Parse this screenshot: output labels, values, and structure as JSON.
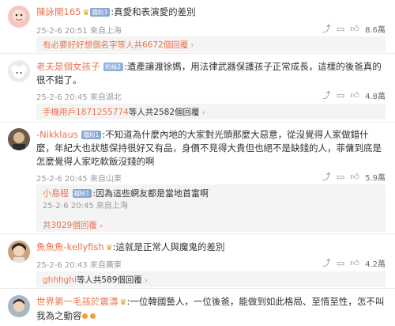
{
  "comments": [
    {
      "username": "陳詠開165",
      "badge": "鐵粉3",
      "separator": ":",
      "text": "真愛和表演愛的差別",
      "time": "25-2-6 20:51",
      "location": "來自上海",
      "likes": "8.6萬",
      "reply_summary": "有必要好好想個名字等人共6672個回覆",
      "avatar_icon": "avatar-pink-face"
    },
    {
      "username": "老夫是個女孩子",
      "badge": "粉絲2",
      "separator": ":",
      "text": "遺產讓渡徐媽，用法律武器保護孩子正常成長，這樣的後爸真的很不錯了。",
      "time": "25-2-6 20:45",
      "location": "來自湖北",
      "likes": "4.8萬",
      "reply_summary_user": "手機用戶1871255774",
      "reply_summary_rest": "等人共2582個回覆",
      "avatar_icon": "avatar-sheep"
    },
    {
      "username": "-Nikklaus",
      "badge": "鐵粉1",
      "separator": ":",
      "text": "不知道為什麼內地的大家對光頭那麼大惡意，從沒覺得人家做錯什麼，年紀大也狀態保持很好又有品，身價不見得大貴但也絕不是缺錢的人，菲傭到底是怎麼覺得人家吃軟飯沒錢的啊",
      "time": "25-2-6 20:45",
      "location": "來自山東",
      "likes": "5.9萬",
      "subreply": {
        "username": "小島程",
        "badge": "鐵粉1",
        "separator": ":",
        "text": "因為這些網友都是當地首富啊",
        "time": "25-2-6 20:45",
        "location": "來自上海"
      },
      "reply_summary": "共3029個回覆",
      "avatar_icon": "avatar-man"
    },
    {
      "username": "魚魚魚-kellyfish",
      "separator": ":",
      "text": "這就是正常人與魔鬼的差別",
      "time": "25-2-6 20:43",
      "location": "來自廣東",
      "likes": "4.2萬",
      "reply_summary_user": "ghhhghi",
      "reply_summary_rest": "等人共589個回覆",
      "avatar_icon": "avatar-woman"
    },
    {
      "username": "世界第一毛孩於震濤",
      "separator": ":",
      "text": "一位韓國藝人，一位後爸，能做到如此格局、至情至性，怎不叫我為之動容",
      "avatar_icon": "avatar-boy"
    }
  ],
  "icons": {
    "share": "share-icon",
    "comment": "comment-icon",
    "like": "thumbs-up-icon",
    "chevron": "chevron-right-icon"
  },
  "colors": {
    "accent": "#eb7350",
    "meta": "#9a9a9a",
    "badge": "#8aa8d6"
  }
}
